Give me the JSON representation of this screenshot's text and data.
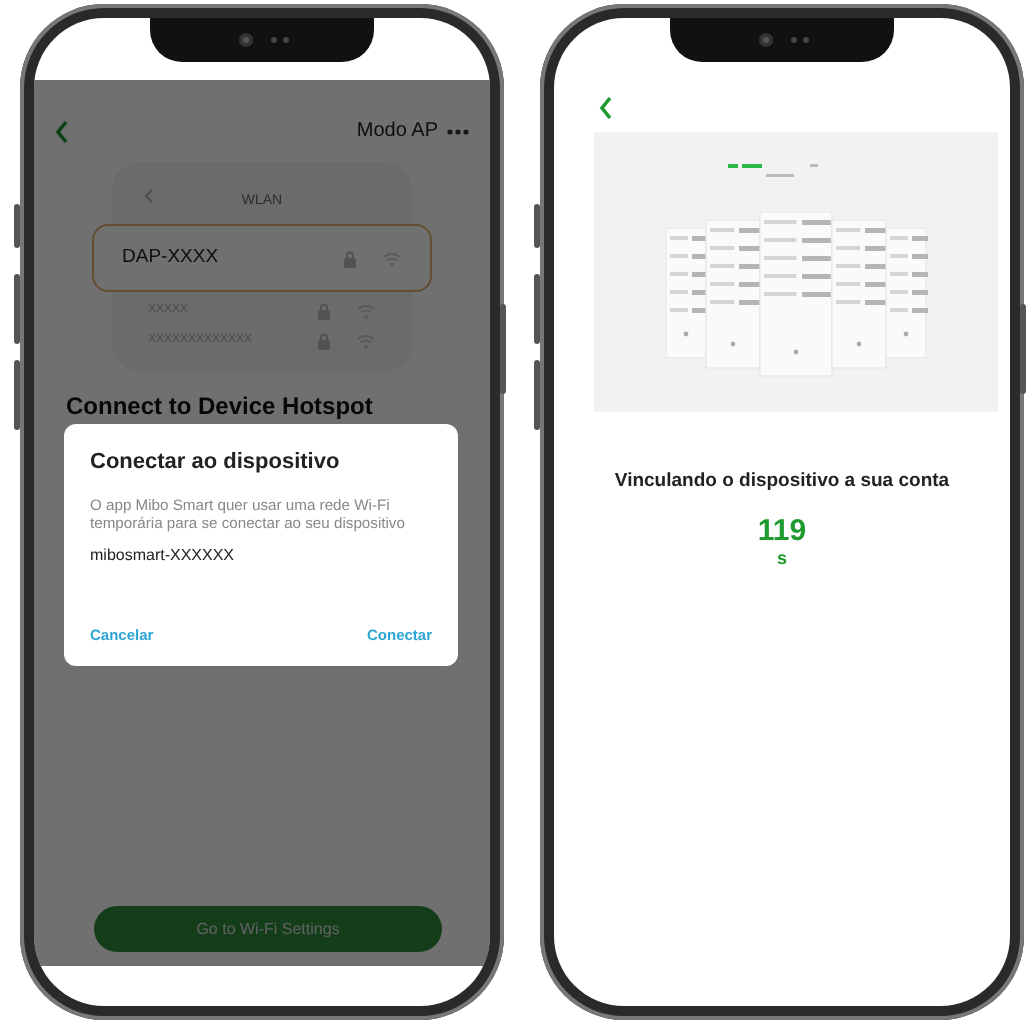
{
  "left_screen": {
    "header": {
      "title": "Modo AP"
    },
    "wlan_illustration": {
      "title": "WLAN",
      "networks": [
        {
          "name": "DAP-XXXX",
          "selected": true
        },
        {
          "name": "XXXXX",
          "selected": false
        },
        {
          "name": "XXXXXXXXXXXXX",
          "selected": false
        }
      ]
    },
    "heading": "Connect to Device Hotspot",
    "button": "Go to Wi-Fi Settings",
    "dialog": {
      "title": "Conectar ao dispositivo",
      "message": "O app Mibo Smart quer usar uma rede Wi-Fi temporária para se conectar ao seu dispositivo",
      "network": "mibosmart-XXXXXX",
      "cancel": "Cancelar",
      "confirm": "Conectar"
    }
  },
  "right_screen": {
    "title": "Vinculando o dispositivo a sua conta",
    "countdown": "119",
    "unit": "s"
  }
}
